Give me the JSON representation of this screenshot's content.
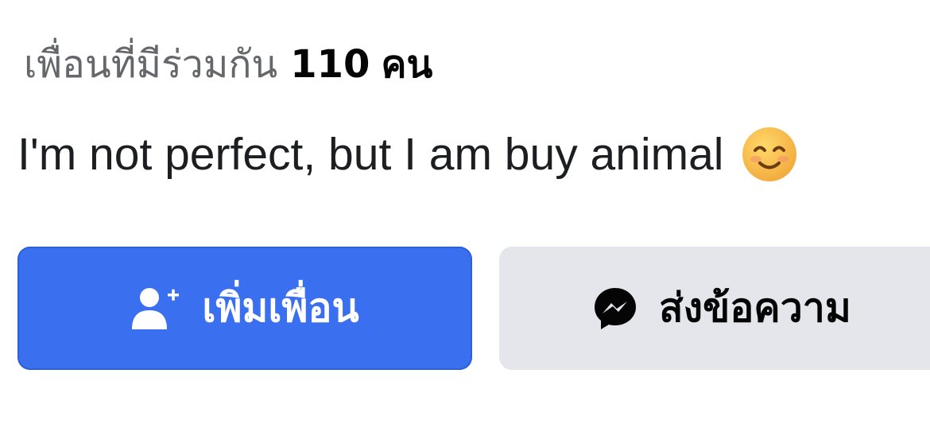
{
  "profile": {
    "mutual_label": "เพื่อนที่มีร่วมกัน",
    "mutual_count": "110",
    "mutual_unit": "คน",
    "bio": "I'm not perfect, but I am buy animal"
  },
  "actions": {
    "add_friend_label": "เพิ่มเพื่อน",
    "message_label": "ส่งข้อความ"
  },
  "icons": {
    "add_friend": "add-friend-icon",
    "message": "messenger-icon",
    "emoji": "smiling-face-emoji"
  },
  "colors": {
    "primary": "#3a6ff0",
    "secondary_bg": "#e4e6eb",
    "muted_text": "#65676b",
    "text": "#050505"
  }
}
